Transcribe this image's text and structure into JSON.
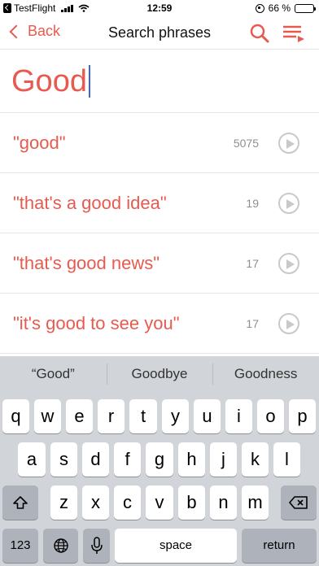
{
  "status_bar": {
    "carrier": "TestFlight",
    "time": "12:59",
    "battery": "66 %",
    "battery_level": 0.66
  },
  "nav": {
    "back_label": "Back",
    "title": "Search phrases",
    "search_icon": "search-icon",
    "menu_icon": "list-menu-icon"
  },
  "search": {
    "query": "Good"
  },
  "results": [
    {
      "phrase": "\"good\"",
      "count": "5075"
    },
    {
      "phrase": "\"that's a good idea\"",
      "count": "19"
    },
    {
      "phrase": "\"that's good news\"",
      "count": "17"
    },
    {
      "phrase": "\"it's good to see you\"",
      "count": "17"
    }
  ],
  "keyboard": {
    "suggestions": [
      "“Good”",
      "Goodbye",
      "Goodness"
    ],
    "row1": [
      "q",
      "w",
      "e",
      "r",
      "t",
      "y",
      "u",
      "i",
      "o",
      "p"
    ],
    "row2": [
      "a",
      "s",
      "d",
      "f",
      "g",
      "h",
      "j",
      "k",
      "l"
    ],
    "row3": [
      "z",
      "x",
      "c",
      "v",
      "b",
      "n",
      "m"
    ],
    "numbers_label": "123",
    "space_label": "space",
    "return_label": "return"
  },
  "colors": {
    "accent": "#e85a4f",
    "cursor": "#3a66d6",
    "keyboard_bg": "#d1d4d9"
  }
}
